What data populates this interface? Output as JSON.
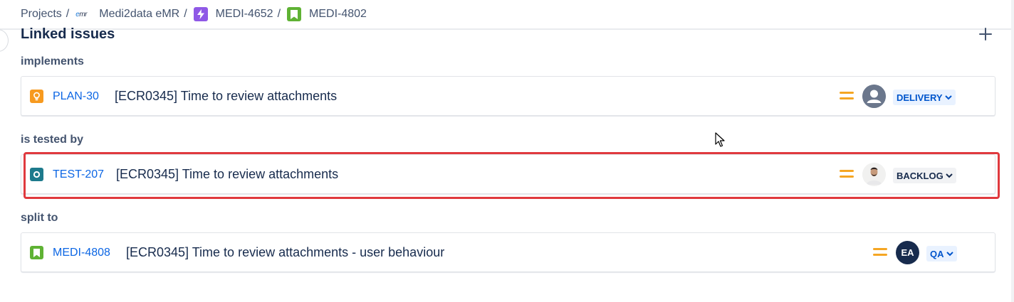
{
  "breadcrumb": {
    "items": [
      {
        "label": "Projects"
      },
      {
        "label": "Medi2data eMR",
        "logo_text": "emr"
      },
      {
        "label": "MEDI-4652",
        "icon": "epic-lightning-icon"
      },
      {
        "label": "MEDI-4802",
        "icon": "story-bookmark-icon"
      }
    ],
    "separator": "/"
  },
  "section": {
    "title": "Linked issues",
    "add_icon": "plus-icon"
  },
  "groups": [
    {
      "label": "implements",
      "issue": {
        "type_icon": "idea-lightbulb-icon",
        "type_color": "#f79a1f",
        "key": "PLAN-30",
        "summary": "[ECR0345] Time to review attachments",
        "priority": "medium-priority-icon",
        "assignee": "default-user-avatar",
        "status": "DELIVERY",
        "status_bg": "#e9f2ff",
        "status_color": "#0055cc"
      }
    },
    {
      "label": "is tested by",
      "issue": {
        "type_icon": "test-circle-icon",
        "type_color": "#1d7a8c",
        "key": "TEST-207",
        "summary": "[ECR0345] Time to review attachments",
        "priority": "medium-priority-icon",
        "assignee": "photo-avatar",
        "status": "BACKLOG",
        "status_bg": "#f1f2f4",
        "status_color": "#172b4d"
      }
    },
    {
      "label": "split to",
      "issue": {
        "type_icon": "story-bookmark-icon",
        "type_color": "#5fb234",
        "key": "MEDI-4808",
        "summary": "[ECR0345] Time to review attachments - user behaviour",
        "priority": "medium-priority-icon",
        "assignee": "initials-avatar",
        "assignee_initials": "EA",
        "status": "QA",
        "status_bg": "#e9f2ff",
        "status_color": "#0055cc"
      }
    }
  ],
  "colors": {
    "link": "#0c66e4",
    "highlight_border": "#e0393e",
    "priority_medium": "#f5a623",
    "initials_avatar_bg": "#172b4d"
  }
}
